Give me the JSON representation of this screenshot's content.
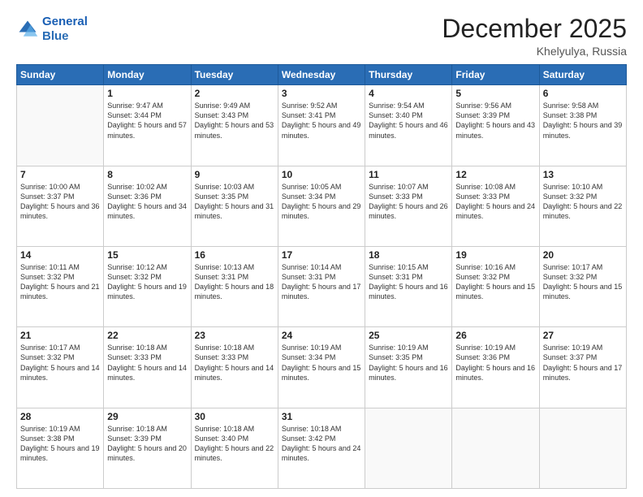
{
  "logo": {
    "line1": "General",
    "line2": "Blue"
  },
  "title": "December 2025",
  "subtitle": "Khelyulya, Russia",
  "header": {
    "days": [
      "Sunday",
      "Monday",
      "Tuesday",
      "Wednesday",
      "Thursday",
      "Friday",
      "Saturday"
    ]
  },
  "weeks": [
    [
      {
        "day": "",
        "sunrise": "",
        "sunset": "",
        "daylight": ""
      },
      {
        "day": "1",
        "sunrise": "Sunrise: 9:47 AM",
        "sunset": "Sunset: 3:44 PM",
        "daylight": "Daylight: 5 hours and 57 minutes."
      },
      {
        "day": "2",
        "sunrise": "Sunrise: 9:49 AM",
        "sunset": "Sunset: 3:43 PM",
        "daylight": "Daylight: 5 hours and 53 minutes."
      },
      {
        "day": "3",
        "sunrise": "Sunrise: 9:52 AM",
        "sunset": "Sunset: 3:41 PM",
        "daylight": "Daylight: 5 hours and 49 minutes."
      },
      {
        "day": "4",
        "sunrise": "Sunrise: 9:54 AM",
        "sunset": "Sunset: 3:40 PM",
        "daylight": "Daylight: 5 hours and 46 minutes."
      },
      {
        "day": "5",
        "sunrise": "Sunrise: 9:56 AM",
        "sunset": "Sunset: 3:39 PM",
        "daylight": "Daylight: 5 hours and 43 minutes."
      },
      {
        "day": "6",
        "sunrise": "Sunrise: 9:58 AM",
        "sunset": "Sunset: 3:38 PM",
        "daylight": "Daylight: 5 hours and 39 minutes."
      }
    ],
    [
      {
        "day": "7",
        "sunrise": "Sunrise: 10:00 AM",
        "sunset": "Sunset: 3:37 PM",
        "daylight": "Daylight: 5 hours and 36 minutes."
      },
      {
        "day": "8",
        "sunrise": "Sunrise: 10:02 AM",
        "sunset": "Sunset: 3:36 PM",
        "daylight": "Daylight: 5 hours and 34 minutes."
      },
      {
        "day": "9",
        "sunrise": "Sunrise: 10:03 AM",
        "sunset": "Sunset: 3:35 PM",
        "daylight": "Daylight: 5 hours and 31 minutes."
      },
      {
        "day": "10",
        "sunrise": "Sunrise: 10:05 AM",
        "sunset": "Sunset: 3:34 PM",
        "daylight": "Daylight: 5 hours and 29 minutes."
      },
      {
        "day": "11",
        "sunrise": "Sunrise: 10:07 AM",
        "sunset": "Sunset: 3:33 PM",
        "daylight": "Daylight: 5 hours and 26 minutes."
      },
      {
        "day": "12",
        "sunrise": "Sunrise: 10:08 AM",
        "sunset": "Sunset: 3:33 PM",
        "daylight": "Daylight: 5 hours and 24 minutes."
      },
      {
        "day": "13",
        "sunrise": "Sunrise: 10:10 AM",
        "sunset": "Sunset: 3:32 PM",
        "daylight": "Daylight: 5 hours and 22 minutes."
      }
    ],
    [
      {
        "day": "14",
        "sunrise": "Sunrise: 10:11 AM",
        "sunset": "Sunset: 3:32 PM",
        "daylight": "Daylight: 5 hours and 21 minutes."
      },
      {
        "day": "15",
        "sunrise": "Sunrise: 10:12 AM",
        "sunset": "Sunset: 3:32 PM",
        "daylight": "Daylight: 5 hours and 19 minutes."
      },
      {
        "day": "16",
        "sunrise": "Sunrise: 10:13 AM",
        "sunset": "Sunset: 3:31 PM",
        "daylight": "Daylight: 5 hours and 18 minutes."
      },
      {
        "day": "17",
        "sunrise": "Sunrise: 10:14 AM",
        "sunset": "Sunset: 3:31 PM",
        "daylight": "Daylight: 5 hours and 17 minutes."
      },
      {
        "day": "18",
        "sunrise": "Sunrise: 10:15 AM",
        "sunset": "Sunset: 3:31 PM",
        "daylight": "Daylight: 5 hours and 16 minutes."
      },
      {
        "day": "19",
        "sunrise": "Sunrise: 10:16 AM",
        "sunset": "Sunset: 3:32 PM",
        "daylight": "Daylight: 5 hours and 15 minutes."
      },
      {
        "day": "20",
        "sunrise": "Sunrise: 10:17 AM",
        "sunset": "Sunset: 3:32 PM",
        "daylight": "Daylight: 5 hours and 15 minutes."
      }
    ],
    [
      {
        "day": "21",
        "sunrise": "Sunrise: 10:17 AM",
        "sunset": "Sunset: 3:32 PM",
        "daylight": "Daylight: 5 hours and 14 minutes."
      },
      {
        "day": "22",
        "sunrise": "Sunrise: 10:18 AM",
        "sunset": "Sunset: 3:33 PM",
        "daylight": "Daylight: 5 hours and 14 minutes."
      },
      {
        "day": "23",
        "sunrise": "Sunrise: 10:18 AM",
        "sunset": "Sunset: 3:33 PM",
        "daylight": "Daylight: 5 hours and 14 minutes."
      },
      {
        "day": "24",
        "sunrise": "Sunrise: 10:19 AM",
        "sunset": "Sunset: 3:34 PM",
        "daylight": "Daylight: 5 hours and 15 minutes."
      },
      {
        "day": "25",
        "sunrise": "Sunrise: 10:19 AM",
        "sunset": "Sunset: 3:35 PM",
        "daylight": "Daylight: 5 hours and 16 minutes."
      },
      {
        "day": "26",
        "sunrise": "Sunrise: 10:19 AM",
        "sunset": "Sunset: 3:36 PM",
        "daylight": "Daylight: 5 hours and 16 minutes."
      },
      {
        "day": "27",
        "sunrise": "Sunrise: 10:19 AM",
        "sunset": "Sunset: 3:37 PM",
        "daylight": "Daylight: 5 hours and 17 minutes."
      }
    ],
    [
      {
        "day": "28",
        "sunrise": "Sunrise: 10:19 AM",
        "sunset": "Sunset: 3:38 PM",
        "daylight": "Daylight: 5 hours and 19 minutes."
      },
      {
        "day": "29",
        "sunrise": "Sunrise: 10:18 AM",
        "sunset": "Sunset: 3:39 PM",
        "daylight": "Daylight: 5 hours and 20 minutes."
      },
      {
        "day": "30",
        "sunrise": "Sunrise: 10:18 AM",
        "sunset": "Sunset: 3:40 PM",
        "daylight": "Daylight: 5 hours and 22 minutes."
      },
      {
        "day": "31",
        "sunrise": "Sunrise: 10:18 AM",
        "sunset": "Sunset: 3:42 PM",
        "daylight": "Daylight: 5 hours and 24 minutes."
      },
      {
        "day": "",
        "sunrise": "",
        "sunset": "",
        "daylight": ""
      },
      {
        "day": "",
        "sunrise": "",
        "sunset": "",
        "daylight": ""
      },
      {
        "day": "",
        "sunrise": "",
        "sunset": "",
        "daylight": ""
      }
    ]
  ]
}
